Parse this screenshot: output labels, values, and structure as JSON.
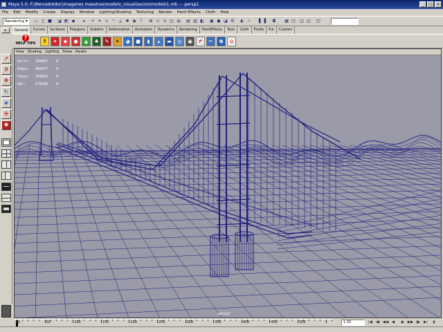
{
  "window": {
    "title": "Maya 5.0: F:\\Mercedotdoc\\imagenes maestras\\modelo_visualizacion\\modelo1.mb  ---  persp2",
    "controls": [
      "_",
      "□",
      "×"
    ]
  },
  "menubar": [
    "File",
    "Edit",
    "Modify",
    "Create",
    "Display",
    "Window",
    "Lighting/Shading",
    "Texturing",
    "Render",
    "Paint Effects",
    "Cloth",
    "Help"
  ],
  "statusline": {
    "mode": "Rendering"
  },
  "shelf": {
    "tabs": [
      "General",
      "Curves",
      "Surfaces",
      "Polygons",
      "Subdivs",
      "Deformation",
      "Animation",
      "Dynamics",
      "Rendering",
      "PaintEffects",
      "Toon",
      "Cloth",
      "Fluids",
      "Fur",
      "Custom"
    ],
    "active_tab": "General",
    "help_label": "HELP",
    "tips_label": "TIPS"
  },
  "viewport": {
    "menu": [
      "View",
      "Shading",
      "Lighting",
      "Show",
      "Panels"
    ],
    "camera": "persp2",
    "hud": [
      {
        "label": "Verts:",
        "v1": "209067",
        "v2": "0"
      },
      {
        "label": "Edges:",
        "v1": "460027",
        "v2": "0"
      },
      {
        "label": "Faces:",
        "v1": "169033",
        "v2": "0"
      },
      {
        "label": "UVs:",
        "v1": "679590",
        "v2": "0"
      }
    ],
    "colors": {
      "background": "#9a9aa8",
      "wireframe": "#1c1c7e"
    }
  },
  "timeline": {
    "ticks": [
      "1",
      "50",
      "100",
      "150",
      "200",
      "250",
      "300",
      "350",
      "400",
      "450",
      "500",
      "550",
      "600",
      "650",
      "700",
      "750"
    ],
    "current_frame": "1.00"
  }
}
